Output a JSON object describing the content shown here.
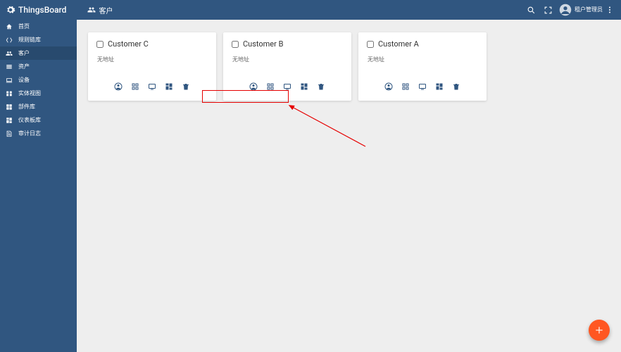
{
  "header": {
    "brand": "ThingsBoard",
    "page_title": "客户",
    "account_label": "租户管理员"
  },
  "sidebar": {
    "items": [
      {
        "id": "home",
        "label": "首页",
        "icon": "home"
      },
      {
        "id": "rules",
        "label": "规则链库",
        "icon": "rules"
      },
      {
        "id": "customers",
        "label": "客户",
        "icon": "customers",
        "active": true
      },
      {
        "id": "assets",
        "label": "资产",
        "icon": "assets"
      },
      {
        "id": "devices",
        "label": "设备",
        "icon": "devices"
      },
      {
        "id": "views",
        "label": "实体视图",
        "icon": "views"
      },
      {
        "id": "widgets",
        "label": "部件库",
        "icon": "widgets"
      },
      {
        "id": "dashboards",
        "label": "仪表板库",
        "icon": "dashboards"
      },
      {
        "id": "audit",
        "label": "审计日志",
        "icon": "audit"
      }
    ]
  },
  "customers": [
    {
      "name": "Customer A",
      "address": "无地址"
    },
    {
      "name": "Customer B",
      "address": "无地址"
    },
    {
      "name": "Customer C",
      "address": "无地址"
    }
  ],
  "colors": {
    "primary": "#305680",
    "fab": "#ff5722",
    "highlight": "#e60000"
  }
}
